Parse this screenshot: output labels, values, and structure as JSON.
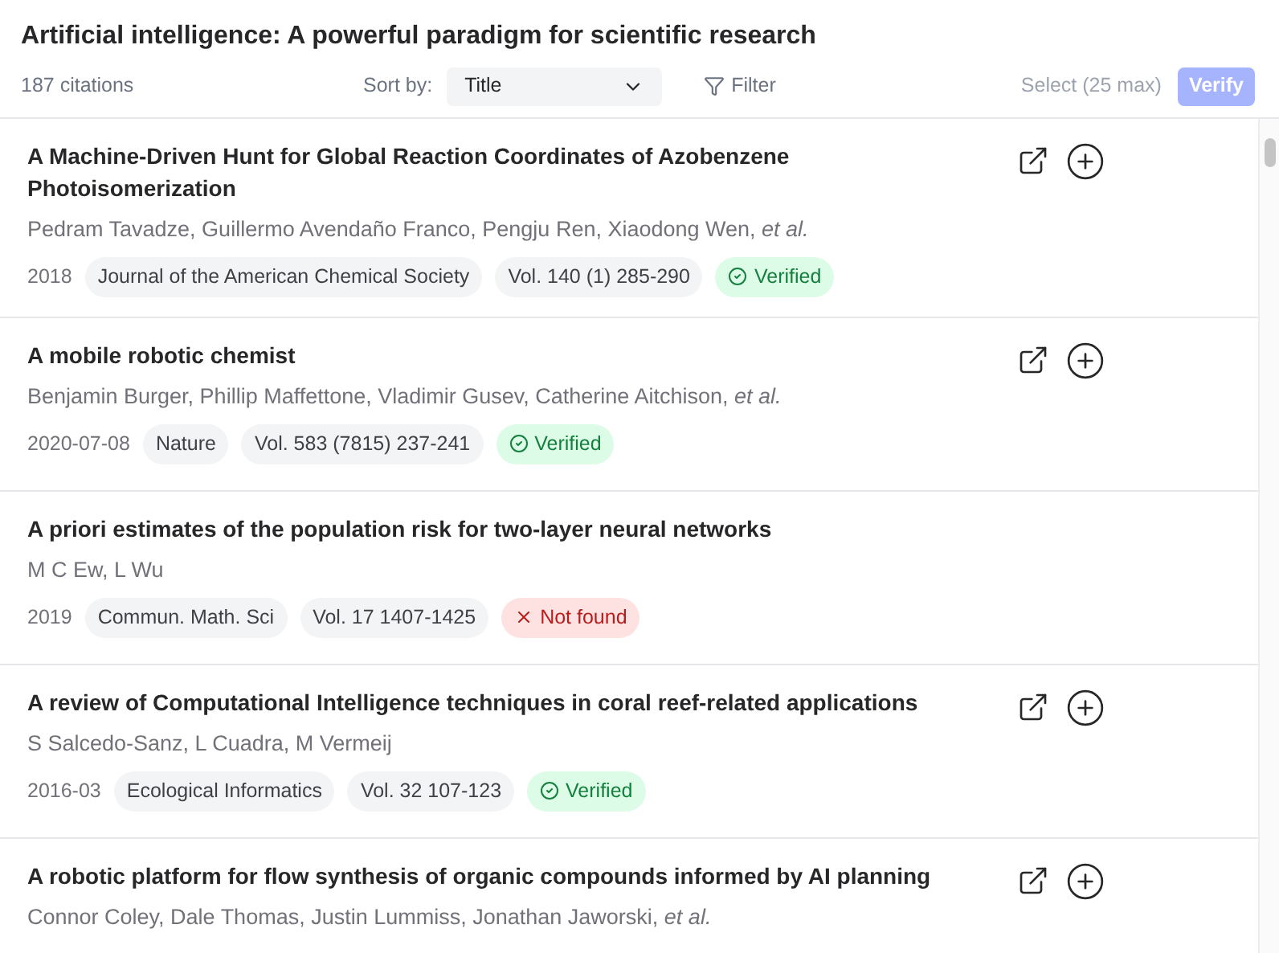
{
  "title": "Artificial intelligence: A powerful paradigm for scientific research",
  "toolbar": {
    "count": "187 citations",
    "sort_label": "Sort by:",
    "sort_value": "Title",
    "filter": "Filter",
    "select_hint": "Select (25 max)",
    "verify": "Verify",
    "verify_disabled": true
  },
  "citations": [
    {
      "title": "A Machine-Driven Hunt for Global Reaction Coordinates of Azobenzene Photoisomerization",
      "authors": "Pedram Tavadze, Guillermo Avendaño Franco, Pengju Ren, Xiaodong Wen, *et al.*",
      "date": "2018",
      "journal": "Journal of the American Chemical Society",
      "volume": "Vol. 140 (1) 285-290",
      "status": {
        "kind": "verified",
        "label": "Verified"
      },
      "actions": true
    },
    {
      "title": "A mobile robotic chemist",
      "authors": "Benjamin Burger, Phillip Maffettone, Vladimir Gusev, Catherine Aitchison, *et al.*",
      "date": "2020-07-08",
      "journal": "Nature",
      "volume": "Vol. 583 (7815) 237-241",
      "status": {
        "kind": "verified",
        "label": "Verified"
      },
      "actions": true
    },
    {
      "title": "A priori estimates of the population risk for two-layer neural networks",
      "authors": "M C Ew, L Wu",
      "date": "2019",
      "journal": "Commun. Math. Sci",
      "volume": "Vol. 17 1407-1425",
      "status": {
        "kind": "not_found",
        "label": "Not found"
      },
      "actions": false
    },
    {
      "title": "A review of Computational Intelligence techniques in coral reef-related applications",
      "authors": "S Salcedo-Sanz, L Cuadra, M Vermeij",
      "date": "2016-03",
      "journal": "Ecological Informatics",
      "volume": "Vol. 32 107-123",
      "status": {
        "kind": "verified",
        "label": "Verified"
      },
      "actions": true
    },
    {
      "title": "A robotic platform for flow synthesis of organic compounds informed by AI planning",
      "authors": "Connor Coley, Dale Thomas, Justin Lummiss, Jonathan Jaworski, *et al.*",
      "actions": true
    }
  ]
}
